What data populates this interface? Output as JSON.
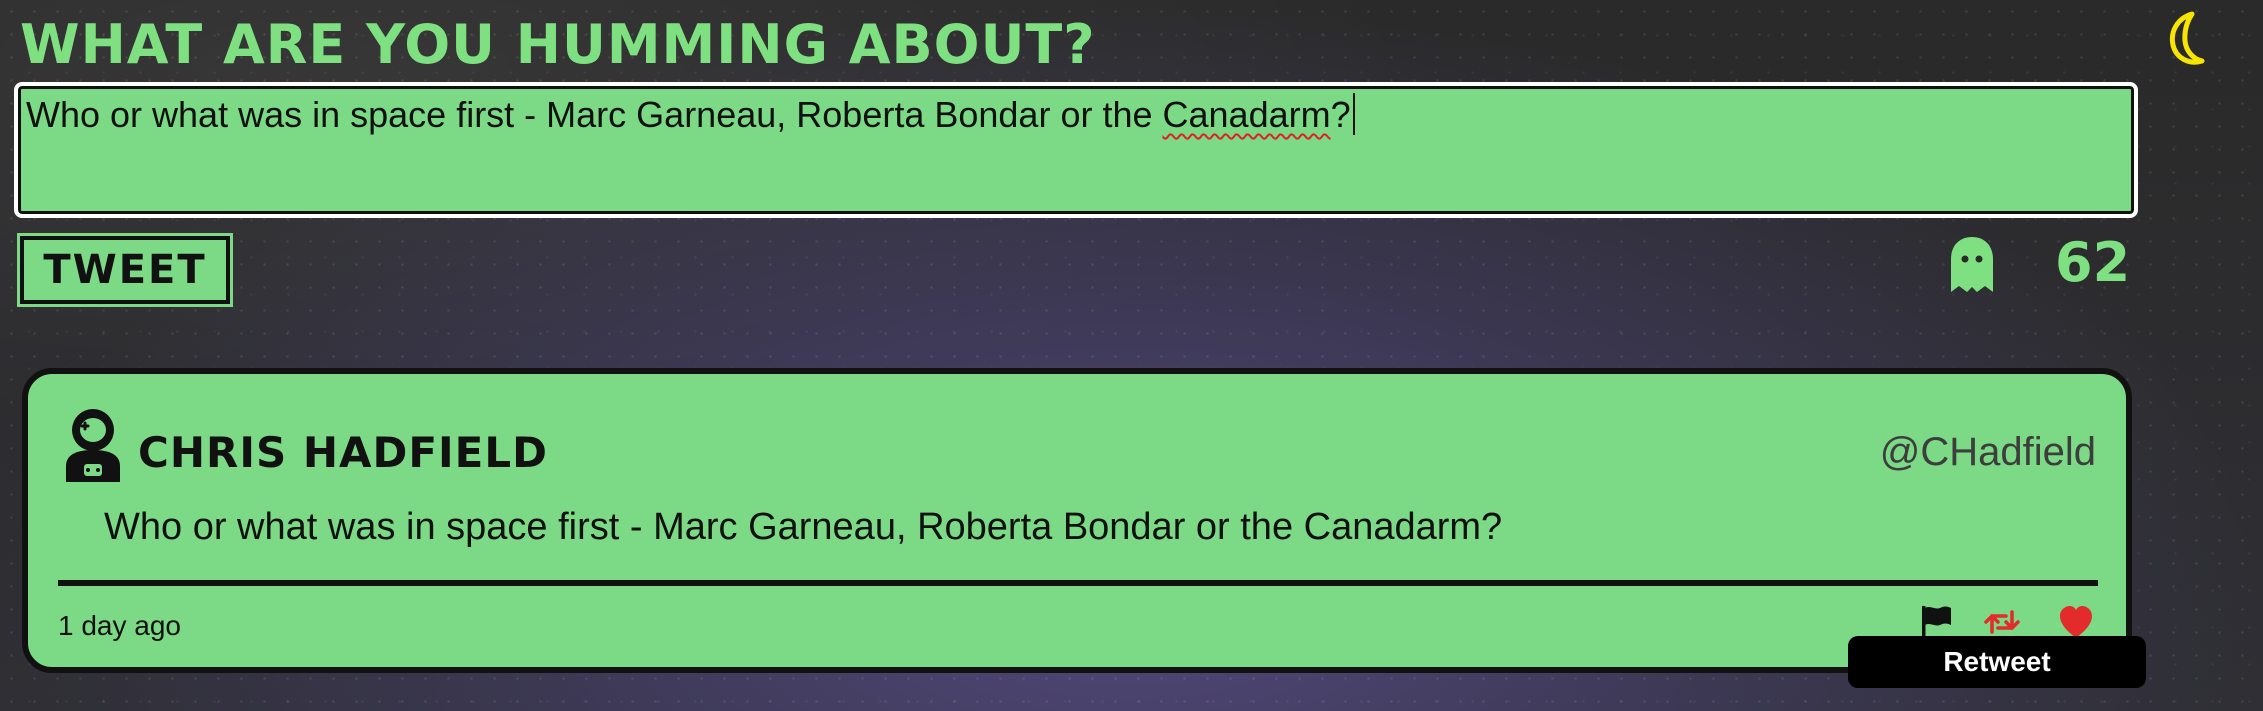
{
  "composer": {
    "heading": "WHAT ARE YOU HUMMING ABOUT?",
    "value_before_misspelling": "Who or what was in space first - Marc Garneau, Roberta Bondar or the ",
    "misspelled_word": "Canadarm",
    "value_after_misspelling": "?",
    "tweet_button_label": "TWEET",
    "remaining_characters": "62"
  },
  "theme": {
    "mode_toggle_icon": "moon-icon",
    "accent_color": "#7ee081",
    "moon_color": "#f7e400"
  },
  "tweet": {
    "author_name": "CHRIS HADFIELD",
    "handle": "@CHadfield",
    "text": "Who or what was in space first - Marc Garneau, Roberta Bondar or the Canadarm?",
    "timestamp": "1 day ago",
    "avatar_icon": "astronaut-icon",
    "actions": [
      {
        "name": "flag",
        "icon": "flag-icon"
      },
      {
        "name": "retweet",
        "icon": "retweet-icon",
        "color": "#e32b2b"
      },
      {
        "name": "like",
        "icon": "heart-icon",
        "color": "#e32b2b"
      }
    ]
  },
  "tooltip": {
    "label": "Retweet"
  }
}
